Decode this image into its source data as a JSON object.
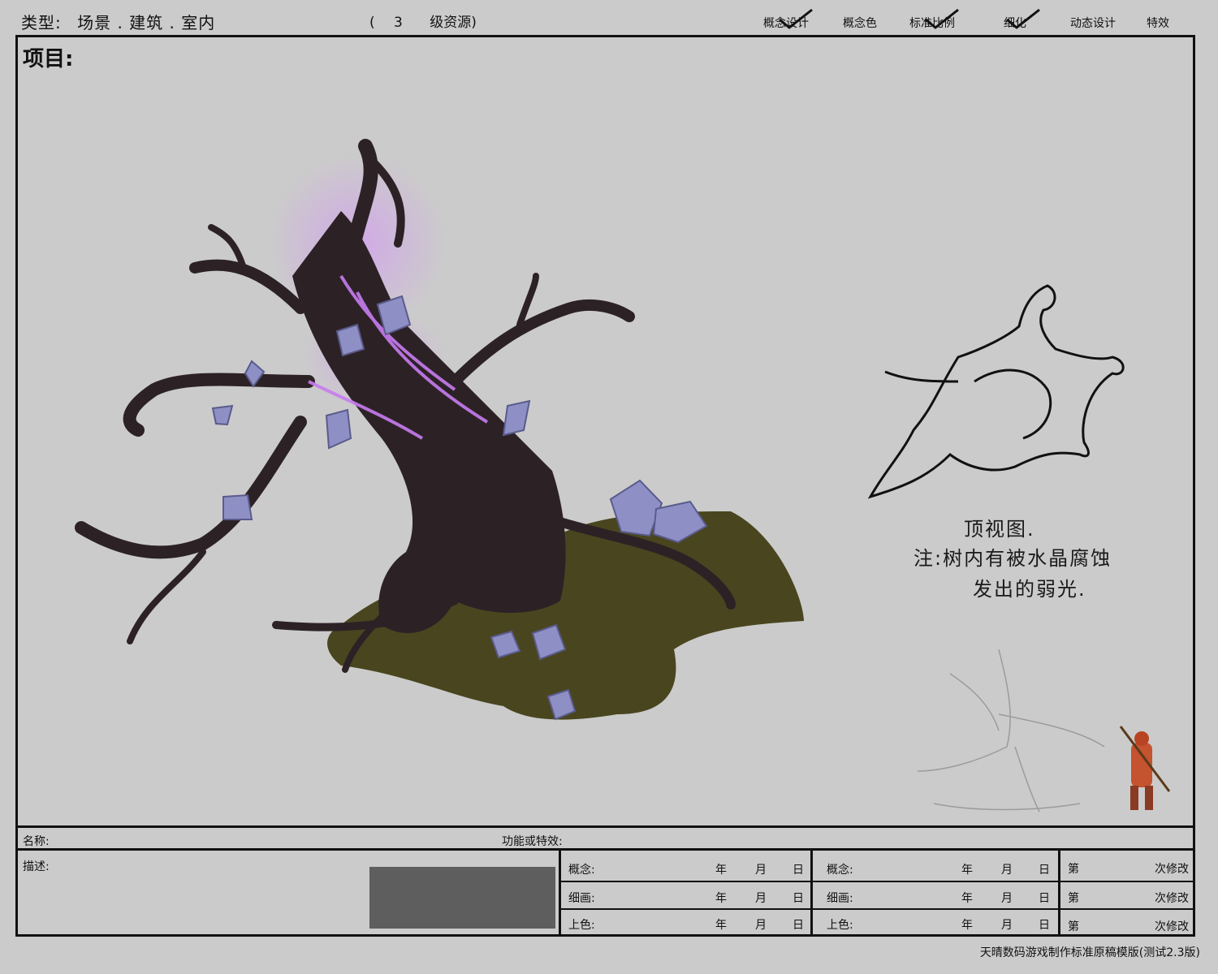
{
  "header": {
    "type_label": "类型:",
    "type_value": "场景 . 建筑 . 室内",
    "level_open": "(",
    "level_num": "3",
    "level_text": "级资源)",
    "stages": [
      {
        "label": "概念设计",
        "checked": true
      },
      {
        "label": "概念色",
        "checked": false
      },
      {
        "label": "标准比例",
        "checked": true
      },
      {
        "label": "细化",
        "checked": true
      },
      {
        "label": "动态设计",
        "checked": false
      },
      {
        "label": "特效",
        "checked": false
      }
    ]
  },
  "project_label": "项目:",
  "notes": {
    "top_view": "顶视图.",
    "note_line1": "注:树内有被水晶腐蚀",
    "note_line2": "发出的弱光."
  },
  "form": {
    "name_label": "名称:",
    "effect_label": "功能或特效:",
    "desc_label": "描述:",
    "rows": [
      {
        "stage": "概念:",
        "stage2": "概念:",
        "nth": "第",
        "rev": "次修改"
      },
      {
        "stage": "细画:",
        "stage2": "细画:",
        "nth": "第",
        "rev": "次修改"
      },
      {
        "stage": "上色:",
        "stage2": "上色:",
        "nth": "第",
        "rev": "次修改"
      }
    ],
    "year": "年",
    "month": "月",
    "day": "日"
  },
  "footer": "天晴数码游戏制作标准原稿模版(测试2.3版)",
  "colors": {
    "glow": "#c87cf0",
    "bark": "#2c2226",
    "crystal": "#8e8fc4",
    "shadow": "#4a4620"
  }
}
